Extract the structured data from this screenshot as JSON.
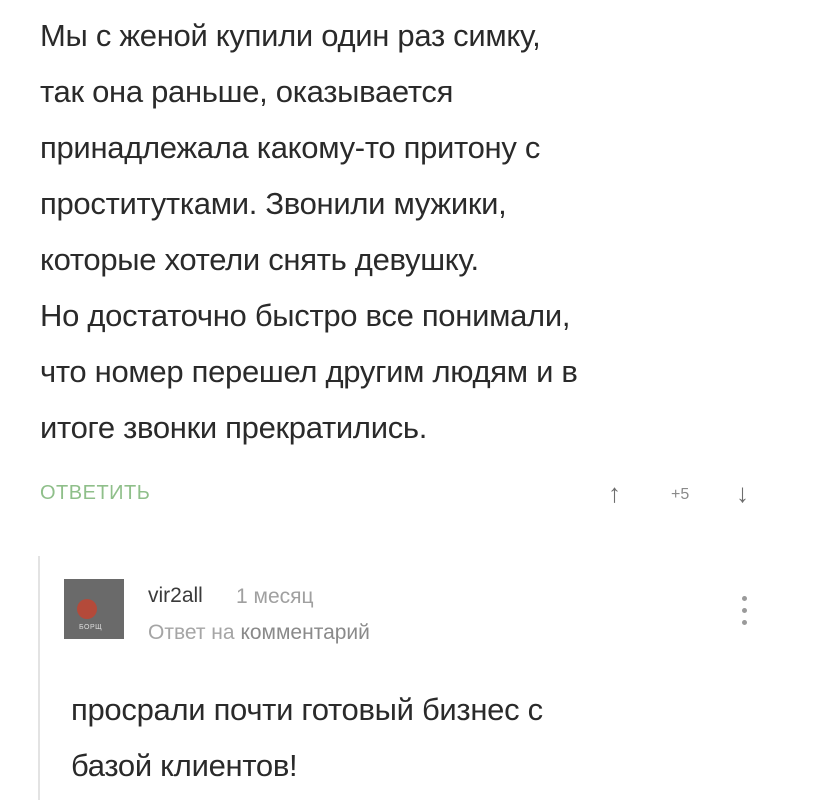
{
  "comment": {
    "text_lines": [
      "Мы с женой купили один раз симку,",
      "так она раньше,  оказывается",
      "принадлежала какому-то притону с",
      "проститутками. Звонили мужики,",
      "которые хотели снять девушку.",
      "Но достаточно быстро все понимали,",
      "что номер перешел другим людям и в",
      "итоге звонки прекратились."
    ],
    "reply_label": "ОТВЕТИТЬ",
    "vote_up_icon": "arrow-up-icon",
    "vote_down_icon": "arrow-down-icon",
    "vote_up_glyph": "↑",
    "vote_down_glyph": "↓",
    "rating": "+5",
    "reply_color": "#8fbf8a"
  },
  "reply": {
    "avatar_text": "БОРЩ",
    "author": "vir2all",
    "time": "1 месяц",
    "context_prefix": "Ответ на",
    "context_link": "комментарий",
    "more_icon": "more-vertical-icon",
    "text_lines": [
      "просрали почти готовый бизнес с",
      "базой клиентов!"
    ]
  }
}
